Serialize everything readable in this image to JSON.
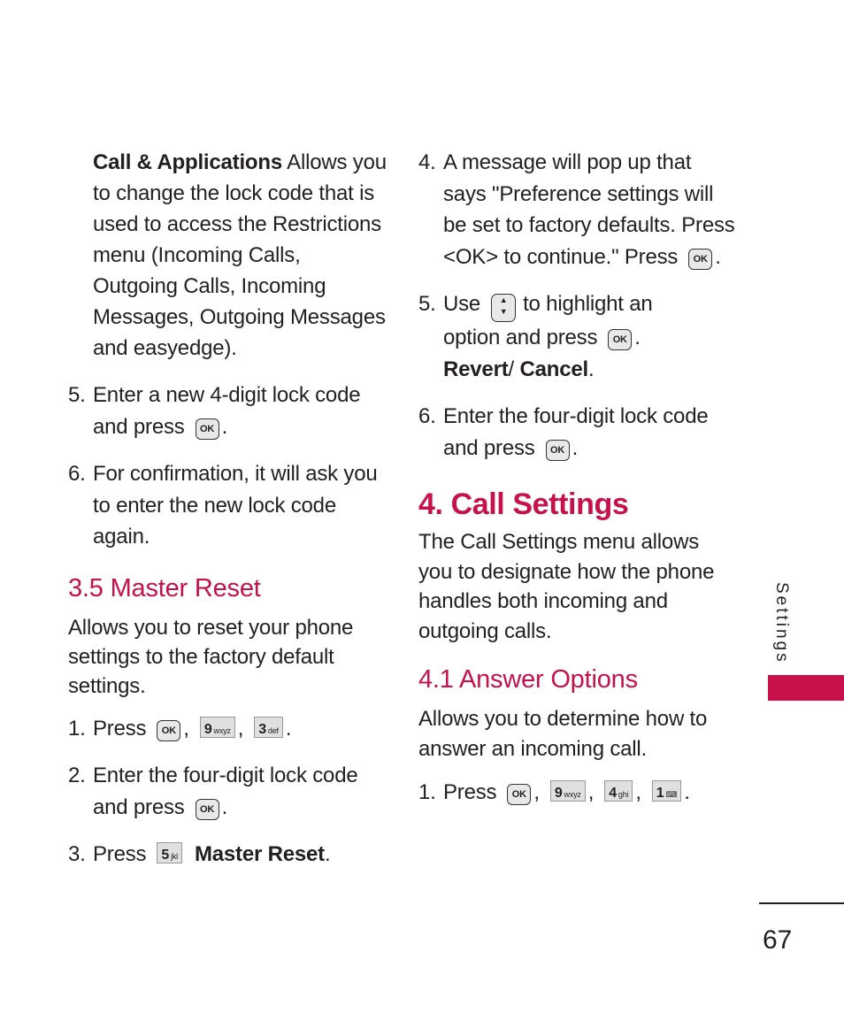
{
  "left_column": {
    "intro": {
      "bold_lead": "Call & Applications",
      "text": " Allows you to change the lock code that is used to access the Restrictions menu (Incoming Calls, Outgoing Calls, Incoming Messages, Outgoing Messages and easyedge)."
    },
    "steps_a": [
      {
        "num": "5.",
        "text": "Enter a new 4-digit lock code and press",
        "suffix": "."
      },
      {
        "num": "6.",
        "text": "For confirmation, it will ask you to enter the new lock code again."
      }
    ],
    "master_reset": {
      "heading": "3.5 Master Reset",
      "body": "Allows you to reset your phone settings to the factory default settings.",
      "step1": {
        "num": "1.",
        "text": "Press",
        "sep": ",",
        "end": "."
      },
      "step2": {
        "num": "2.",
        "text": "Enter the four-digit lock code and press",
        "suffix": "."
      },
      "step3": {
        "num": "3.",
        "text": "Press",
        "bold": "Master Reset",
        "end": "."
      }
    }
  },
  "right_column": {
    "step4": {
      "num": "4.",
      "text": "A message will pop up that says \"Preference settings will be set to factory defaults. Press <OK> to continue.\" Press",
      "suffix": "."
    },
    "step5": {
      "num": "5.",
      "pre": "Use",
      "mid": "to highlight an option and press",
      "suffix": ".",
      "bold1": "Revert",
      "slash": "/ ",
      "bold2": "Cancel",
      "end": "."
    },
    "step6": {
      "num": "6.",
      "text": "Enter the four-digit lock code and press",
      "suffix": "."
    },
    "call_settings": {
      "heading": "4. Call Settings",
      "body": "The Call Settings menu allows you to designate how the phone handles both incoming and outgoing calls."
    },
    "answer_options": {
      "heading": "4.1 Answer Options",
      "body": "Allows you to determine how to answer an incoming call.",
      "step1": {
        "num": "1.",
        "text": "Press",
        "sep": ",",
        "end": "."
      }
    }
  },
  "keys": {
    "ok": "OK",
    "nav_up": "▲",
    "nav_down": "▼",
    "k9": {
      "digit": "9",
      "letters": "wxyz"
    },
    "k3": {
      "digit": "3",
      "letters": "def"
    },
    "k5": {
      "digit": "5",
      "letters": "jkl"
    },
    "k4": {
      "digit": "4",
      "letters": "ghi"
    },
    "k1": {
      "digit": "1",
      "letters": "⌨"
    }
  },
  "sidebar": {
    "label": "Settings",
    "accent_color": "#c8104a"
  },
  "footer": {
    "page_number": "67"
  }
}
